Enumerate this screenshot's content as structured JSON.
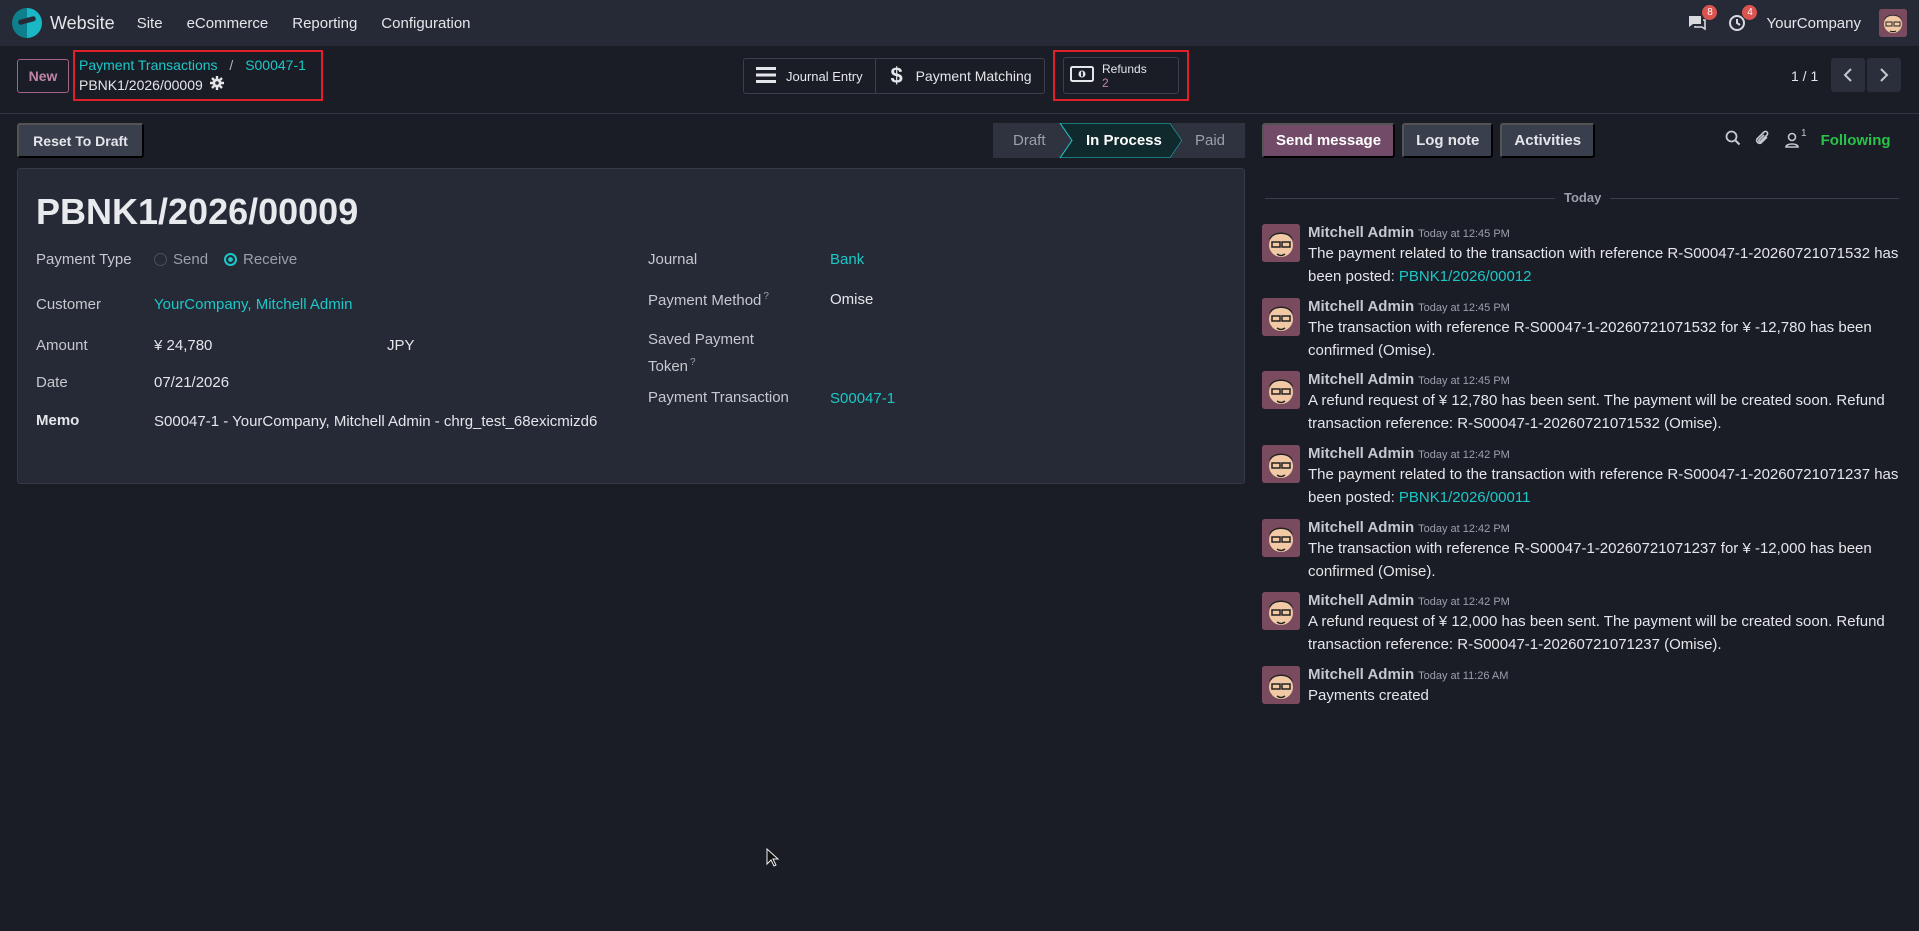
{
  "navbar": {
    "app_name": "Website",
    "menu": [
      "Site",
      "eCommerce",
      "Reporting",
      "Configuration"
    ],
    "messages_badge": "8",
    "activities_badge": "4",
    "company": "YourCompany"
  },
  "control_panel": {
    "new_label": "New",
    "breadcrumb_parent": "Payment Transactions",
    "breadcrumb_separator": "/",
    "breadcrumb_current": "S00047-1",
    "record_name": "PBNK1/2026/00009",
    "smart_buttons": {
      "journal_entry": "Journal Entry",
      "payment_matching": "Payment Matching",
      "refunds_label": "Refunds",
      "refunds_count": "2"
    },
    "pager": "1 / 1"
  },
  "status": {
    "reset_label": "Reset To Draft",
    "stages": [
      "Draft",
      "In Process",
      "Paid"
    ],
    "active_stage": "In Process"
  },
  "form": {
    "title": "PBNK1/2026/00009",
    "payment_type_label": "Payment Type",
    "payment_type_options": [
      "Send",
      "Receive"
    ],
    "payment_type_value": "Receive",
    "customer_label": "Customer",
    "customer_value": "YourCompany, Mitchell Admin",
    "amount_label": "Amount",
    "amount_value": "¥ 24,780",
    "currency_value": "JPY",
    "date_label": "Date",
    "date_value": "07/21/2026",
    "memo_label": "Memo",
    "memo_value": "S00047-1 - YourCompany, Mitchell Admin - chrg_test_68exicmizd6",
    "journal_label": "Journal",
    "journal_value": "Bank",
    "payment_method_label": "Payment Method",
    "payment_method_value": "Omise",
    "saved_token_label_1": "Saved Payment",
    "saved_token_label_2": "Token",
    "payment_transaction_label": "Payment Transaction",
    "payment_transaction_value": "S00047-1",
    "help_mark": "?"
  },
  "chatter": {
    "send_message": "Send message",
    "log_note": "Log note",
    "activities": "Activities",
    "followers_count": "1",
    "following": "Following",
    "date_separator": "Today",
    "messages": [
      {
        "author": "Mitchell Admin",
        "date": "Today at 12:45 PM",
        "text": "The payment related to the transaction with reference R-S00047-1-20260721071532 has been posted: ",
        "link": "PBNK1/2026/00012"
      },
      {
        "author": "Mitchell Admin",
        "date": "Today at 12:45 PM",
        "text": "The transaction with reference R-S00047-1-20260721071532 for ¥ -12,780 has been confirmed (Omise).",
        "link": ""
      },
      {
        "author": "Mitchell Admin",
        "date": "Today at 12:45 PM",
        "text": "A refund request of ¥ 12,780 has been sent. The payment will be created soon. Refund transaction reference: R-S00047-1-20260721071532 (Omise).",
        "link": ""
      },
      {
        "author": "Mitchell Admin",
        "date": "Today at 12:42 PM",
        "text": "The payment related to the transaction with reference R-S00047-1-20260721071237 has been posted: ",
        "link": "PBNK1/2026/00011"
      },
      {
        "author": "Mitchell Admin",
        "date": "Today at 12:42 PM",
        "text": "The transaction with reference R-S00047-1-20260721071237 for ¥ -12,000 has been confirmed (Omise).",
        "link": ""
      },
      {
        "author": "Mitchell Admin",
        "date": "Today at 12:42 PM",
        "text": "A refund request of ¥ 12,000 has been sent. The payment will be created soon. Refund transaction reference: R-S00047-1-20260721071237 (Omise).",
        "link": ""
      },
      {
        "author": "Mitchell Admin",
        "date": "Today at 11:26 AM",
        "text": "Payments created",
        "link": ""
      }
    ]
  },
  "colors": {
    "background": "#1b1d26",
    "accent_teal": "#1cc7c7",
    "primary_purple": "#714b67",
    "following_green": "#29c24a",
    "highlight_red": "#e0202a"
  }
}
